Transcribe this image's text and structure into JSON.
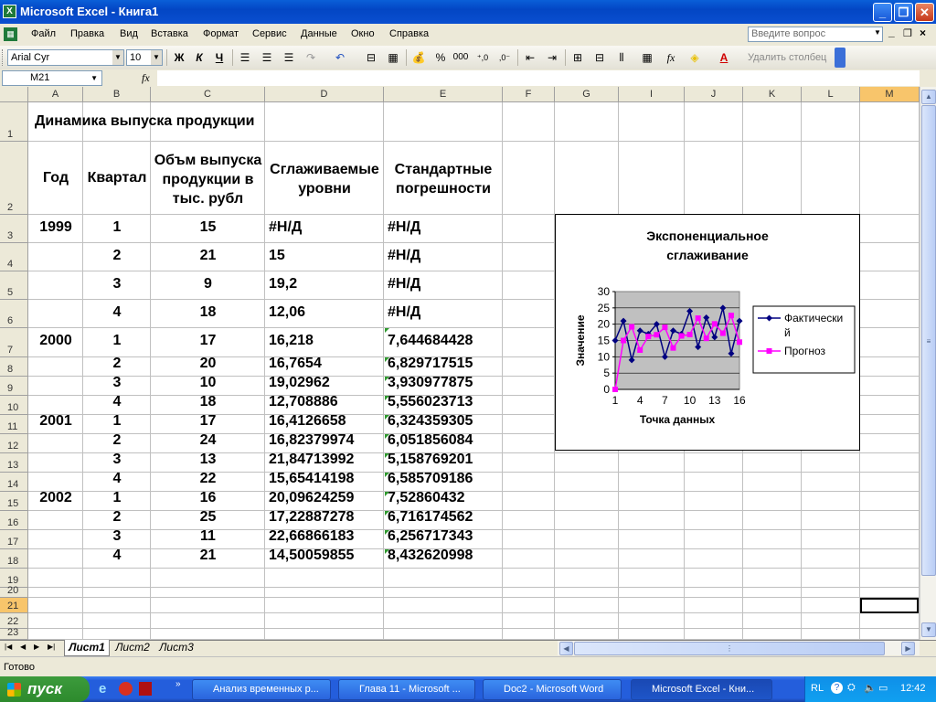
{
  "window": {
    "title": "Microsoft Excel - Книга1",
    "minimize": "_",
    "restore": "❐",
    "close": "✕"
  },
  "menu": {
    "items": [
      "Файл",
      "Правка",
      "Вид",
      "Вставка",
      "Формат",
      "Сервис",
      "Данные",
      "Окно",
      "Справка"
    ],
    "ask_placeholder": "Введите вопрос"
  },
  "toolbar": {
    "font": "Arial Cyr",
    "size": "10",
    "bold": "Ж",
    "italic": "К",
    "underline": "Ч",
    "percent": "%",
    "thousands": "000",
    "inc_dec": ",0 ,00",
    "dec_dec": ",00 ,0",
    "fx": "fx",
    "delete_column": "Удалить столбец"
  },
  "formula_bar": {
    "name_box": "M21",
    "fx": "fx",
    "value": ""
  },
  "columns": [
    "A",
    "B",
    "C",
    "D",
    "E",
    "F",
    "G",
    "I",
    "J",
    "K",
    "L",
    "M"
  ],
  "selected_column": "M",
  "rows": [
    "1",
    "2",
    "3",
    "4",
    "5",
    "6",
    "7",
    "8",
    "9",
    "10",
    "11",
    "12",
    "13",
    "14",
    "15",
    "16",
    "17",
    "18",
    "19",
    "20",
    "21",
    "22",
    "23"
  ],
  "selected_row": "21",
  "sheet": {
    "title": "Динамика выпуска продукции",
    "headers": {
      "year": "Год",
      "quarter": "Квартал",
      "volume": [
        "Объм выпуска",
        "продукции в",
        "тыс. рубл"
      ],
      "smoothed": [
        "Сглаживаемые",
        "уровни"
      ],
      "errors": [
        "Стандартные",
        "погрешности"
      ]
    },
    "data": [
      {
        "year": "1999",
        "q": "1",
        "v": "15",
        "s": "#Н/Д",
        "e": "#Н/Д"
      },
      {
        "year": "",
        "q": "2",
        "v": "21",
        "s": "15",
        "e": "#Н/Д"
      },
      {
        "year": "",
        "q": "3",
        "v": "9",
        "s": "19,2",
        "e": "#Н/Д"
      },
      {
        "year": "",
        "q": "4",
        "v": "18",
        "s": "12,06",
        "e": "#Н/Д"
      },
      {
        "year": "2000",
        "q": "1",
        "v": "17",
        "s": "16,218",
        "e": "7,644684428"
      },
      {
        "year": "",
        "q": "2",
        "v": "20",
        "s": "16,7654",
        "e": "6,829717515"
      },
      {
        "year": "",
        "q": "3",
        "v": "10",
        "s": "19,02962",
        "e": "3,930977875"
      },
      {
        "year": "",
        "q": "4",
        "v": "18",
        "s": "12,708886",
        "e": "5,556023713"
      },
      {
        "year": "2001",
        "q": "1",
        "v": "17",
        "s": "16,4126658",
        "e": "6,324359305"
      },
      {
        "year": "",
        "q": "2",
        "v": "24",
        "s": "16,82379974",
        "e": "6,051856084"
      },
      {
        "year": "",
        "q": "3",
        "v": "13",
        "s": "21,84713992",
        "e": "5,158769201"
      },
      {
        "year": "",
        "q": "4",
        "v": "22",
        "s": "15,65414198",
        "e": "6,585709186"
      },
      {
        "year": "2002",
        "q": "1",
        "v": "16",
        "s": "20,09624259",
        "e": "7,52860432"
      },
      {
        "year": "",
        "q": "2",
        "v": "25",
        "s": "17,22887278",
        "e": "6,716174562"
      },
      {
        "year": "",
        "q": "3",
        "v": "11",
        "s": "22,66866183",
        "e": "6,256717343"
      },
      {
        "year": "",
        "q": "4",
        "v": "21",
        "s": "14,50059855",
        "e": "8,432620998"
      }
    ]
  },
  "chart_data": {
    "type": "line",
    "title": "Экспоненциальное сглаживание",
    "xlabel": "Точка данных",
    "ylabel": "Значение",
    "ylim": [
      0,
      30
    ],
    "yticks": [
      "0",
      "5",
      "10",
      "15",
      "20",
      "25",
      "30"
    ],
    "xticks": [
      "1",
      "4",
      "7",
      "10",
      "13",
      "16"
    ],
    "x": [
      1,
      2,
      3,
      4,
      5,
      6,
      7,
      8,
      9,
      10,
      11,
      12,
      13,
      14,
      15,
      16
    ],
    "series": [
      {
        "name": "Фактический",
        "color": "#000080",
        "marker": "diamond",
        "values": [
          15,
          21,
          9,
          18,
          17,
          20,
          10,
          18,
          17,
          24,
          13,
          22,
          16,
          25,
          11,
          21
        ]
      },
      {
        "name": "Прогноз",
        "color": "#ff00ff",
        "marker": "square",
        "values": [
          0,
          15,
          19.2,
          12.06,
          16.218,
          16.7654,
          19.02962,
          12.708886,
          16.4126658,
          16.82379974,
          21.84713992,
          15.65414198,
          20.09624259,
          17.22887278,
          22.66866183,
          14.50059855
        ]
      }
    ],
    "legend_position": "right",
    "plot_bg": "#c0c0c0",
    "grid": true
  },
  "sheet_tabs": [
    "Лист1",
    "Лист2",
    "Лист3"
  ],
  "active_tab": "Лист1",
  "status": "Готово",
  "taskbar": {
    "start": "пуск",
    "tasks": [
      "Анализ временных р...",
      "Глава 11 - Microsoft ...",
      "Doc2 - Microsoft Word",
      "Microsoft Excel - Кни..."
    ],
    "lang": "RL",
    "time": "12:42"
  }
}
